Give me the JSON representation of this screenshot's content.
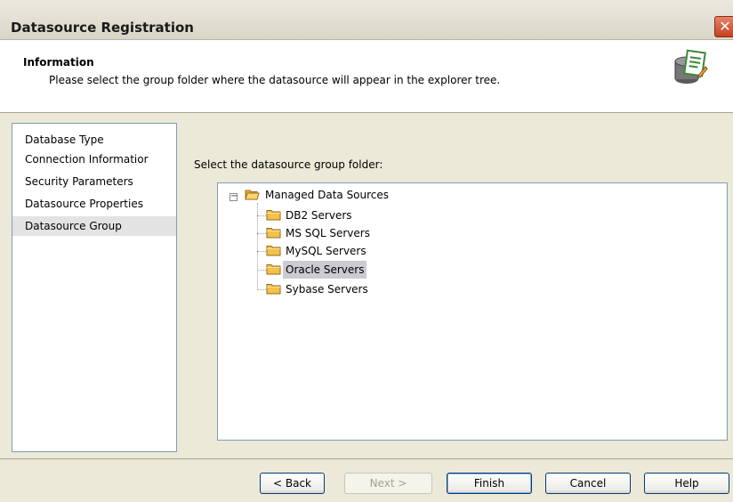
{
  "window": {
    "title": "Datasource Registration"
  },
  "header": {
    "title": "Information",
    "description": "Please select the group folder where the datasource will appear in the explorer tree."
  },
  "nav": {
    "items": [
      {
        "label": "Database Type"
      },
      {
        "label": "Connection Informatior"
      },
      {
        "label": "Security Parameters"
      },
      {
        "label": "Datasource Properties"
      },
      {
        "label": "Datasource Group",
        "selected": true
      }
    ]
  },
  "content": {
    "prompt": "Select the datasource group folder:",
    "tree": {
      "root": {
        "label": "Managed Data Sources",
        "expanded": true
      },
      "children": [
        {
          "label": "DB2 Servers"
        },
        {
          "label": "MS SQL Servers"
        },
        {
          "label": "MySQL Servers"
        },
        {
          "label": "Oracle Servers",
          "selected": true
        },
        {
          "label": "Sybase Servers"
        }
      ]
    }
  },
  "buttons": {
    "back": "< Back",
    "next": "Next >",
    "finish": "Finish",
    "cancel": "Cancel",
    "help": "Help"
  },
  "icons": {
    "close": "close-icon",
    "header": "database-edit-icon",
    "folder": "folder-icon",
    "collapse": "minus-expander-icon"
  },
  "colors": {
    "folder": "#f2c14e",
    "selection": "#cbcbd2",
    "close_button": "#d5553a"
  }
}
